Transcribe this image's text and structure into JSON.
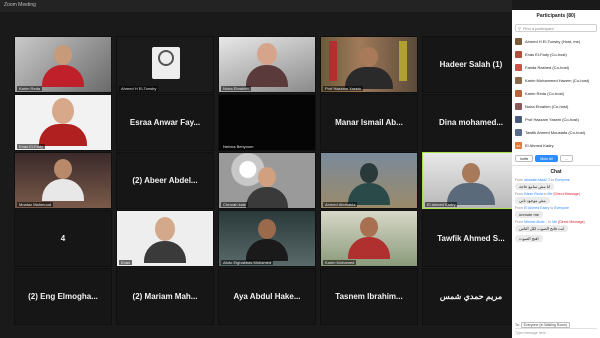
{
  "window": {
    "title": "Zoom Meeting"
  },
  "colors": {
    "active_speaker_border": "#a6e14a",
    "accent": "#2d8cff",
    "panel_bg": "#ffffff",
    "gallery_bg": "#1a1a1a"
  },
  "gallery": {
    "r0": {
      "c0": "Karim Reda",
      "c1": "Ahmed H El-Tonsby",
      "c2": "Noira Ebrahim",
      "c3": "Prof Hazzam Yasein",
      "c4": "Hadeer Salah (1)"
    },
    "r1": {
      "c0": "Enas El-Fady",
      "c1": "Esraa Anwar Fay...",
      "c2": "Neivna Benyoum",
      "c3": "Manar Ismail Ab...",
      "c4": "Dina  mohamed..."
    },
    "r2": {
      "c0": "Moataz Mahmoud",
      "c1": "(2) Abeer Abdel...",
      "c2": "Chrorah kale",
      "c3": "Ahmed Abohabla",
      "c4": "El ahmed Kadry"
    },
    "r3": {
      "c0": "4",
      "c1": "Enas",
      "c2": "Abdo Elghabbas Mohamed",
      "c3": "Karim Mohamed",
      "c4": "Tawfik Ahmed S..."
    },
    "r4": {
      "c0": "(2) Eng Elmogha...",
      "c1": "(2) Mariam Mah...",
      "c2": "Aya Abdul Hake...",
      "c3": "Tasnem  Ibrahim...",
      "c4": "مريم حمدي شمس"
    }
  },
  "participants": {
    "header": "Participants (80)",
    "search_placeholder": "Find a participant",
    "items": [
      {
        "name": "Ahmed H El-Tonsby (Host, me)",
        "color": "#7a5c3a"
      },
      {
        "name": "Enas El-Fady (Co-host)",
        "color": "#b0503a"
      },
      {
        "name": "Farida Rashed (Co-host)",
        "color": "#d0504a"
      },
      {
        "name": "Karim Mohammed Hazem (Co-host)",
        "color": "#8a6a4a"
      },
      {
        "name": "Karim Reda (Co-host)",
        "color": "#c0603a"
      },
      {
        "name": "Noira Ebrahim (Co-host)",
        "color": "#8a5a5a"
      },
      {
        "name": "Prof Hazzam Yasein (Co-host)",
        "color": "#4a5a7a"
      },
      {
        "name": "Tawfik Ahmed Moustafa (Co-host)",
        "color": "#5a6a8a"
      },
      {
        "name": "El Ahmed Kadry",
        "color": "#e0783a",
        "initials": "EA"
      }
    ],
    "invite_label": "Invite",
    "mute_all_label": "Mute All",
    "more_label": "..."
  },
  "chat": {
    "header": "Chat",
    "messages": [
      {
        "from": "abdallah taaa2 2",
        "to": "Everyone",
        "direct": false,
        "text": "انا مش سامع حاجه"
      },
      {
        "from": "Karim Reda",
        "to": "Me",
        "direct": true,
        "text": "مش موجود تاني"
      },
      {
        "from": "El Ahmed Kadry",
        "to": "Everyone",
        "direct": false,
        "text": "unmute me"
      },
      {
        "from": "Mhnice Abde...",
        "to": "Me",
        "direct": true,
        "text": "انت فاتح الصوت لكل الناس"
      },
      {
        "from": "",
        "to": "",
        "direct": false,
        "text": "افتح الصوت"
      }
    ],
    "from_word": "From",
    "to_word": "to",
    "direct_label": "(Direct Message)",
    "to_label": "To:",
    "to_value": "Everyone (in Waiting Room)",
    "compose_placeholder": "Type message here..."
  }
}
